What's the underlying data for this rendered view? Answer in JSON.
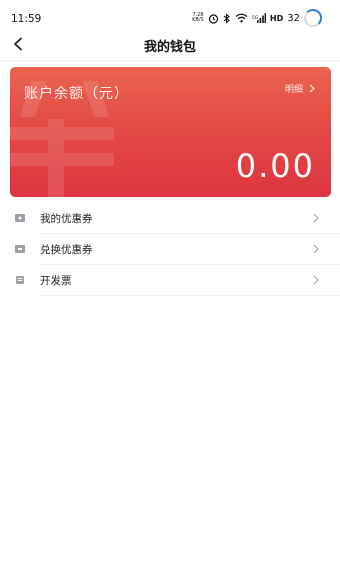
{
  "status_bar": {
    "time": "11:59",
    "speed_value": "7.28",
    "speed_unit": "KB/S",
    "network": "HD",
    "battery": "32"
  },
  "nav": {
    "title": "我的钱包"
  },
  "wallet": {
    "balance_label": "账户余额（元）",
    "detail_label": "明细",
    "balance": "0.00"
  },
  "menu": {
    "items": [
      {
        "label": "我的优惠券",
        "icon": "coupon-icon"
      },
      {
        "label": "兑换优惠券",
        "icon": "exchange-coupon-icon"
      },
      {
        "label": "开发票",
        "icon": "invoice-icon"
      }
    ]
  },
  "colors": {
    "card_top": "#ea6450",
    "card_bottom": "#dd3540",
    "accent_blue": "#2f7be8"
  }
}
